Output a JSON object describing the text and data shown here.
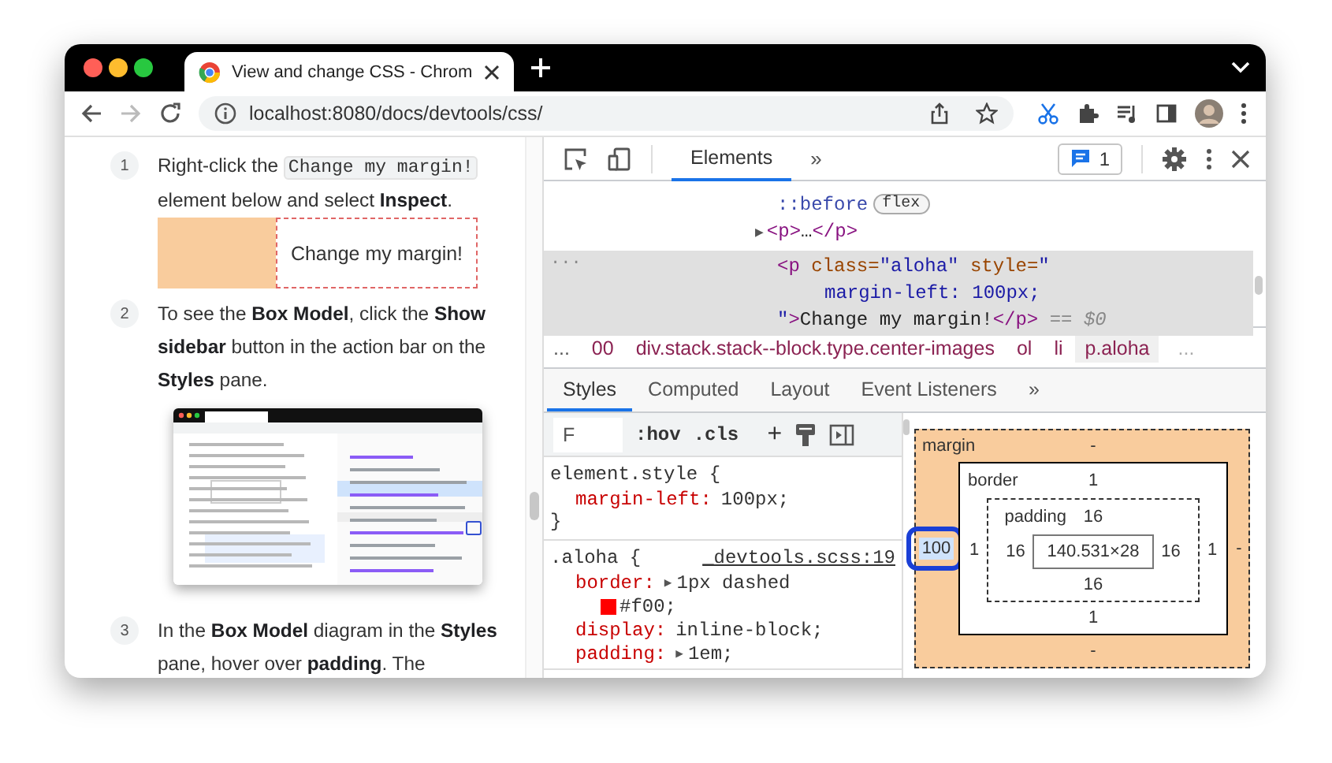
{
  "browser": {
    "tab": {
      "title": "View and change CSS - Chrom",
      "selected": true
    },
    "url": "localhost:8080/docs/devtools/css/",
    "forward_disabled": true
  },
  "page": {
    "steps": [
      {
        "number": "1",
        "parts": [
          {
            "kind": "text",
            "text": "Right-click the "
          },
          {
            "kind": "code",
            "text": "Change my margin!"
          },
          {
            "kind": "text",
            "text": " element below and select **Inspect**."
          }
        ],
        "demo": {
          "text": "Change my margin!"
        }
      },
      {
        "number": "2",
        "parts": [
          {
            "kind": "text",
            "text": "To see the **Box Model**, click the **Show sidebar** button in the action bar on the **Styles** pane."
          }
        ],
        "figure": {
          "kind": "screenshot"
        }
      },
      {
        "number": "3",
        "parts": [
          {
            "kind": "text",
            "text": "In the **Box Model** diagram in the **Styles** pane, hover over **padding**. The"
          }
        ]
      }
    ]
  },
  "devtools": {
    "panel_tabs": [
      {
        "label": "Elements",
        "selected": true
      }
    ],
    "more_tabs": "»",
    "issues": "1",
    "dom": [
      {
        "kind": "pseudo",
        "selected": false,
        "lines": [
          {
            "continuation": false,
            "tokens": [
              {
                "kind": "pseudo",
                "text": "::before"
              },
              {
                "kind": "badge",
                "text": "flex"
              }
            ]
          }
        ]
      },
      {
        "kind": "collapsed",
        "selected": false,
        "toggle": "▶",
        "lines": [
          {
            "continuation": false,
            "tokens": [
              {
                "kind": "tag",
                "text": "<p>"
              },
              {
                "kind": "text",
                "text": "…"
              },
              {
                "kind": "tag",
                "text": "</p>"
              }
            ]
          }
        ]
      },
      {
        "kind": "node",
        "selected": true,
        "menu": "...",
        "lines": [
          {
            "continuation": false,
            "tokens": [
              {
                "kind": "tag",
                "text": "<p"
              },
              {
                "kind": "attr",
                "text": " class="
              },
              {
                "kind": "value",
                "text": "\"aloha\""
              },
              {
                "kind": "attr",
                "text": " style="
              },
              {
                "kind": "value",
                "text": "\""
              }
            ]
          },
          {
            "continuation": true,
            "tokens": [
              {
                "kind": "value",
                "text": "margin-left: 100px;"
              }
            ]
          },
          {
            "continuation": false,
            "tokens": [
              {
                "kind": "value",
                "text": "\""
              },
              {
                "kind": "tag",
                "text": ">"
              },
              {
                "kind": "text",
                "text": "Change my margin!"
              },
              {
                "kind": "tag",
                "text": "</p>"
              },
              {
                "kind": "eq",
                "text": " == $0"
              }
            ]
          }
        ]
      }
    ],
    "breadcrumbs": {
      "lead": "...",
      "items": [
        {
          "text": "00",
          "selected": false
        },
        {
          "text": "div.stack.stack--block.type.center-images",
          "selected": false
        },
        {
          "text": "ol",
          "selected": false
        },
        {
          "text": "li",
          "selected": false
        },
        {
          "text": "p.aloha",
          "selected": true
        }
      ],
      "trail": "..."
    },
    "sidebar_tabs": [
      {
        "label": "Styles",
        "selected": true
      },
      {
        "label": "Computed",
        "selected": false
      },
      {
        "label": "Layout",
        "selected": false
      },
      {
        "label": "Event Listeners",
        "selected": false
      }
    ],
    "sidebar_more": "»",
    "styles": {
      "filter": "F",
      "hov": ":hov",
      "cls": ".cls",
      "add": "+",
      "rules": [
        {
          "selector": "element.style",
          "open": "{",
          "props": [
            {
              "name": "margin-left:",
              "value": "100px;"
            }
          ],
          "close": "}"
        },
        {
          "selector": ".aloha",
          "open": "{",
          "source": "_devtools.scss:19",
          "props": [
            {
              "name": "border:",
              "toggle": "▶",
              "value": "1px dashed",
              "color": "#ff0000",
              "value_cont": "#f00;"
            },
            {
              "name": "display:",
              "value": "inline-block;"
            },
            {
              "name": "padding:",
              "toggle": "▶",
              "value": "1em;"
            }
          ]
        }
      ]
    },
    "box_model": {
      "layers": [
        {
          "kind": "margin",
          "label": "margin",
          "top": {
            "value": "-",
            "selected": false
          },
          "left": {
            "value": "100",
            "selected": true
          },
          "right": {
            "value": "-",
            "selected": false
          },
          "bottom": {
            "value": "-",
            "selected": false
          }
        },
        {
          "kind": "border",
          "label": "border",
          "top": {
            "value": "1",
            "selected": false
          },
          "left": {
            "value": "1",
            "selected": false
          },
          "right": {
            "value": "1",
            "selected": false
          },
          "bottom": {
            "value": "1",
            "selected": false
          }
        },
        {
          "kind": "padding",
          "label": "padding",
          "top": {
            "value": "16",
            "selected": false
          },
          "left": {
            "value": "16",
            "selected": false
          },
          "right": {
            "value": "16",
            "selected": false
          },
          "bottom": {
            "value": "16",
            "selected": false
          }
        }
      ],
      "content": "140.531×28"
    }
  }
}
